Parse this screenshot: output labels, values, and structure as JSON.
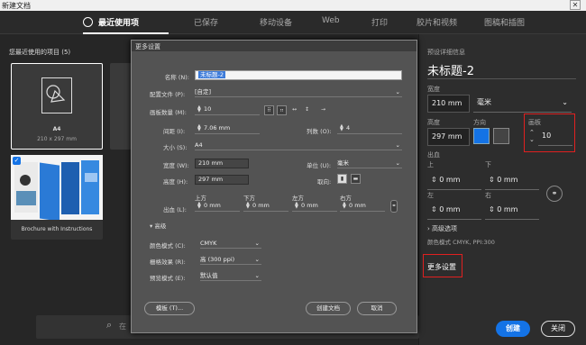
{
  "window": {
    "title": "新建文档",
    "close": "✕"
  },
  "tabs": [
    "最近使用项",
    "已保存",
    "移动设备",
    "Web",
    "打印",
    "胶片和视频",
    "图稿和插图"
  ],
  "recent": {
    "header": "您最近使用的项目",
    "count": "(5)",
    "cards": [
      {
        "name": "A4",
        "size": "210 x 297 mm"
      },
      {
        "name": "Brochure with Instructions"
      }
    ]
  },
  "search": {
    "glyph": "⌕",
    "placeholder": "在"
  },
  "details": {
    "heading": "预设详细信息",
    "doc_name": "未标题-2",
    "width_label": "宽度",
    "width": "210 mm",
    "unit": "毫米",
    "height_label": "高度",
    "height": "297 mm",
    "orientation_label": "方向",
    "artboards_label": "画板",
    "artboards": "10",
    "bleed_label": "出血",
    "top": "上",
    "bottom": "下",
    "left": "左",
    "right": "右",
    "bleed": "0 mm",
    "advanced": "高级选项",
    "color_mode": "颜色模式 CMYK, PPI:300",
    "more": "更多设置",
    "create": "创建",
    "close": "关闭"
  },
  "dialog": {
    "title": "更多设置",
    "name_label": "名称 (N):",
    "name": "未标题-2",
    "profile_label": "配置文件 (P):",
    "profile": "[自定]",
    "artboards_label": "画板数量 (M):",
    "artboards": "10",
    "spacing_label": "间距 (I):",
    "spacing": "7.06 mm",
    "columns_label": "列数 (O):",
    "columns": "4",
    "size_label": "大小 (S):",
    "size": "A4",
    "width_label": "宽度 (W):",
    "width": "210 mm",
    "units_label": "单位 (U):",
    "units": "毫米",
    "height_label": "高度 (H):",
    "height": "297 mm",
    "orient_label": "取向:",
    "bleed_label": "出血 (L):",
    "bleed_top": "上方",
    "bleed_bottom": "下方",
    "bleed_left": "左方",
    "bleed_right": "右方",
    "bleed": "0 mm",
    "advanced": "高级",
    "color_label": "颜色模式 (C):",
    "color": "CMYK",
    "raster_label": "栅格效果 (R):",
    "raster": "高 (300 ppi)",
    "preview_label": "预览模式 (E):",
    "preview": "默认值",
    "template": "模板 (T)...",
    "create": "创建文档",
    "cancel": "取消"
  }
}
